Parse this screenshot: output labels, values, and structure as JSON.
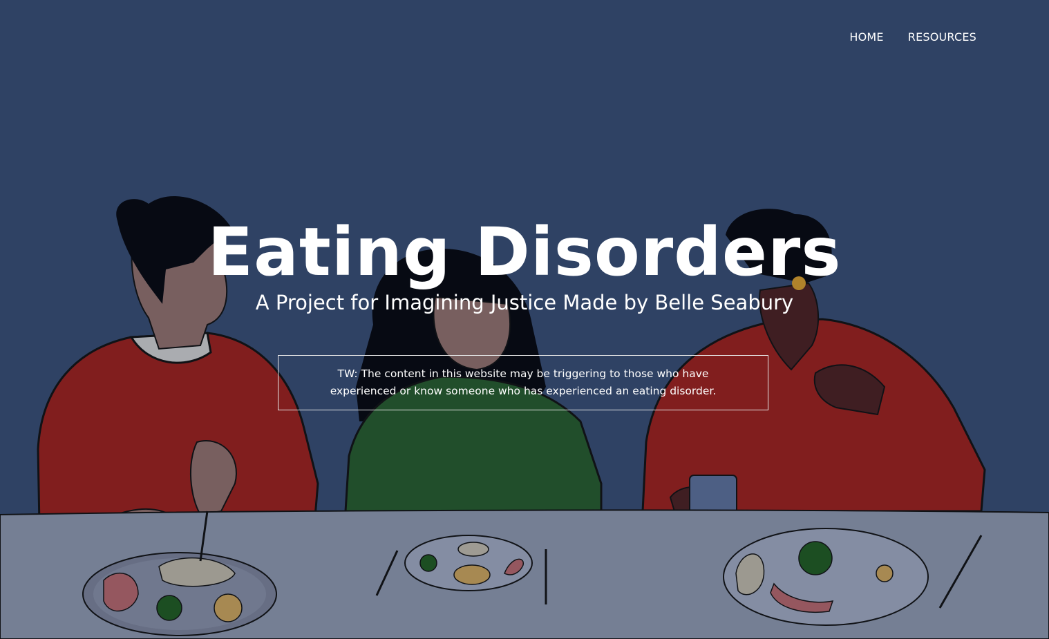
{
  "nav": {
    "items": [
      {
        "label": "HOME"
      },
      {
        "label": "RESOURCES"
      }
    ]
  },
  "hero": {
    "title": "Eating Disorders",
    "subtitle": "A Project for Imagining Justice Made by Belle Seabury",
    "warning": "TW: The content in this website may be triggering to those who have experienced or know someone who has experienced an eating disorder."
  },
  "colors": {
    "background": "#364b6f",
    "table": "#8b95aa",
    "red_shirt": "#9a1f1a",
    "green_shirt": "#255a2a",
    "text": "#ffffff"
  }
}
